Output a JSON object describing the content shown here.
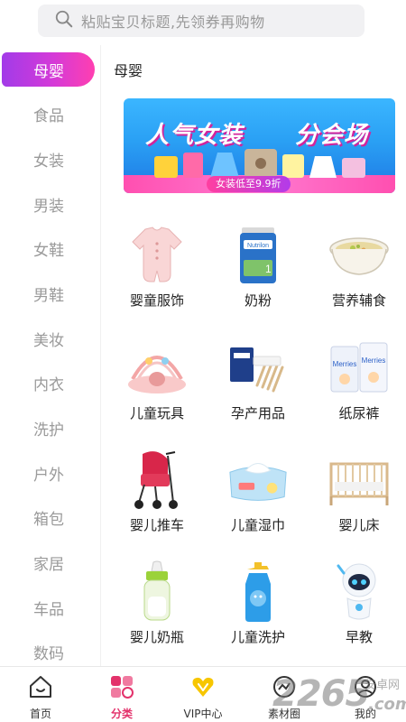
{
  "search": {
    "placeholder": "粘贴宝贝标题,先领券再购物"
  },
  "sidebar": {
    "items": [
      {
        "label": "母婴",
        "active": true
      },
      {
        "label": "食品"
      },
      {
        "label": "女装"
      },
      {
        "label": "男装"
      },
      {
        "label": "女鞋"
      },
      {
        "label": "男鞋"
      },
      {
        "label": "美妆"
      },
      {
        "label": "内衣"
      },
      {
        "label": "洗护"
      },
      {
        "label": "户外"
      },
      {
        "label": "箱包"
      },
      {
        "label": "家居"
      },
      {
        "label": "车品"
      },
      {
        "label": "数码"
      }
    ]
  },
  "main": {
    "section_title": "母婴",
    "banner": {
      "title_left": "人气女装",
      "title_right": "分会场",
      "badge": "女装低至9.9折"
    },
    "items": [
      {
        "label": "婴童服饰",
        "icon": "baby-romper-icon"
      },
      {
        "label": "奶粉",
        "icon": "milk-powder-icon"
      },
      {
        "label": "营养辅食",
        "icon": "baby-food-bowl-icon"
      },
      {
        "label": "儿童玩具",
        "icon": "play-gym-icon"
      },
      {
        "label": "孕产用品",
        "icon": "maternity-kit-icon"
      },
      {
        "label": "纸尿裤",
        "icon": "diaper-pack-icon"
      },
      {
        "label": "婴儿推车",
        "icon": "stroller-icon"
      },
      {
        "label": "儿童湿巾",
        "icon": "wet-wipes-icon"
      },
      {
        "label": "婴儿床",
        "icon": "crib-icon"
      },
      {
        "label": "婴儿奶瓶",
        "icon": "baby-bottle-icon"
      },
      {
        "label": "儿童洗护",
        "icon": "kids-shampoo-icon"
      },
      {
        "label": "早教",
        "icon": "robot-toy-icon"
      }
    ]
  },
  "tabbar": {
    "tabs": [
      {
        "label": "首页",
        "icon": "home-icon"
      },
      {
        "label": "分类",
        "icon": "category-icon",
        "active": true
      },
      {
        "label": "VIP中心",
        "icon": "vip-heart-icon"
      },
      {
        "label": "素材圈",
        "icon": "material-icon"
      },
      {
        "label": "我的",
        "icon": "profile-icon"
      }
    ]
  },
  "watermark": {
    "number": "2265",
    "site": "安卓网",
    "domain": ".com"
  },
  "colors": {
    "accent_purple": "#a23be8",
    "accent_pink": "#ff3fb0",
    "tab_active": "#e3326b",
    "vip_yellow": "#f7c600"
  }
}
